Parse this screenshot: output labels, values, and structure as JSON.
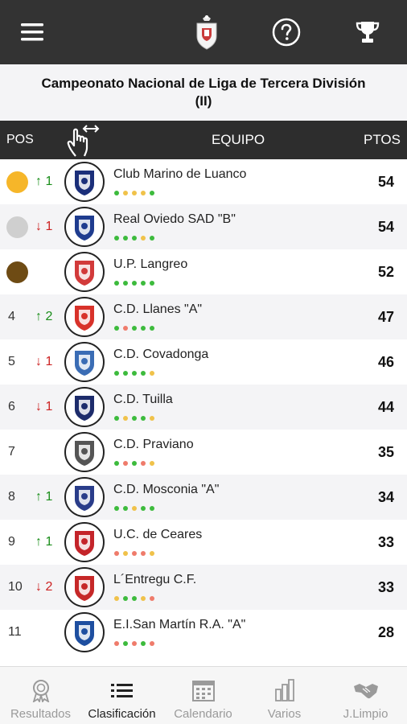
{
  "app": {
    "title": "Campeonato Nacional de Liga de Tercera División (II)"
  },
  "table_header": {
    "pos": "POS",
    "team": "EQUIPO",
    "points": "PTOS"
  },
  "colors": {
    "form_win": "#3dbb3d",
    "form_draw": "#f0c24a",
    "form_loss": "#ef7b6b",
    "gold": "#f6b629",
    "silver": "#cfcfcf",
    "bronze": "#6e4b14"
  },
  "rows": [
    {
      "pos": "",
      "medal": "gold",
      "move": "↑ 1",
      "dir": "up",
      "team": "Club Marino de Luanco",
      "pts": "54",
      "form": [
        "W",
        "D",
        "D",
        "D",
        "W"
      ]
    },
    {
      "pos": "",
      "medal": "silver",
      "move": "↓ 1",
      "dir": "down",
      "team": "Real Oviedo SAD \"B\"",
      "pts": "54",
      "form": [
        "W",
        "W",
        "W",
        "D",
        "W"
      ]
    },
    {
      "pos": "",
      "medal": "bronze",
      "move": "",
      "dir": "",
      "team": "U.P. Langreo",
      "pts": "52",
      "form": [
        "W",
        "W",
        "W",
        "W",
        "W"
      ]
    },
    {
      "pos": "4",
      "medal": "",
      "move": "↑ 2",
      "dir": "up",
      "team": "C.D. Llanes \"A\"",
      "pts": "47",
      "form": [
        "W",
        "L",
        "W",
        "W",
        "W"
      ]
    },
    {
      "pos": "5",
      "medal": "",
      "move": "↓ 1",
      "dir": "down",
      "team": "C.D. Covadonga",
      "pts": "46",
      "form": [
        "W",
        "W",
        "W",
        "W",
        "D"
      ]
    },
    {
      "pos": "6",
      "medal": "",
      "move": "↓ 1",
      "dir": "down",
      "team": "C.D. Tuilla",
      "pts": "44",
      "form": [
        "W",
        "D",
        "W",
        "W",
        "D"
      ]
    },
    {
      "pos": "7",
      "medal": "",
      "move": "",
      "dir": "",
      "team": "C.D. Praviano",
      "pts": "35",
      "form": [
        "W",
        "L",
        "W",
        "L",
        "D"
      ]
    },
    {
      "pos": "8",
      "medal": "",
      "move": "↑ 1",
      "dir": "up",
      "team": "C.D. Mosconia \"A\"",
      "pts": "34",
      "form": [
        "W",
        "W",
        "D",
        "W",
        "W"
      ]
    },
    {
      "pos": "9",
      "medal": "",
      "move": "↑ 1",
      "dir": "up",
      "team": "U.C. de Ceares",
      "pts": "33",
      "form": [
        "L",
        "D",
        "L",
        "L",
        "D"
      ]
    },
    {
      "pos": "10",
      "medal": "",
      "move": "↓ 2",
      "dir": "down",
      "team": "L´Entregu C.F.",
      "pts": "33",
      "form": [
        "D",
        "W",
        "W",
        "D",
        "L"
      ]
    },
    {
      "pos": "11",
      "medal": "",
      "move": "",
      "dir": "",
      "team": "E.I.San Martín R.A. \"A\"",
      "pts": "28",
      "form": [
        "L",
        "W",
        "L",
        "W",
        "L"
      ]
    }
  ],
  "tabs": [
    {
      "label": "Resultados",
      "icon": "medal-icon",
      "active": false
    },
    {
      "label": "Clasificación",
      "icon": "list-icon",
      "active": true
    },
    {
      "label": "Calendario",
      "icon": "calendar-icon",
      "active": false
    },
    {
      "label": "Varios",
      "icon": "bar-chart-icon",
      "active": false
    },
    {
      "label": "J.Limpio",
      "icon": "handshake-icon",
      "active": false
    }
  ]
}
